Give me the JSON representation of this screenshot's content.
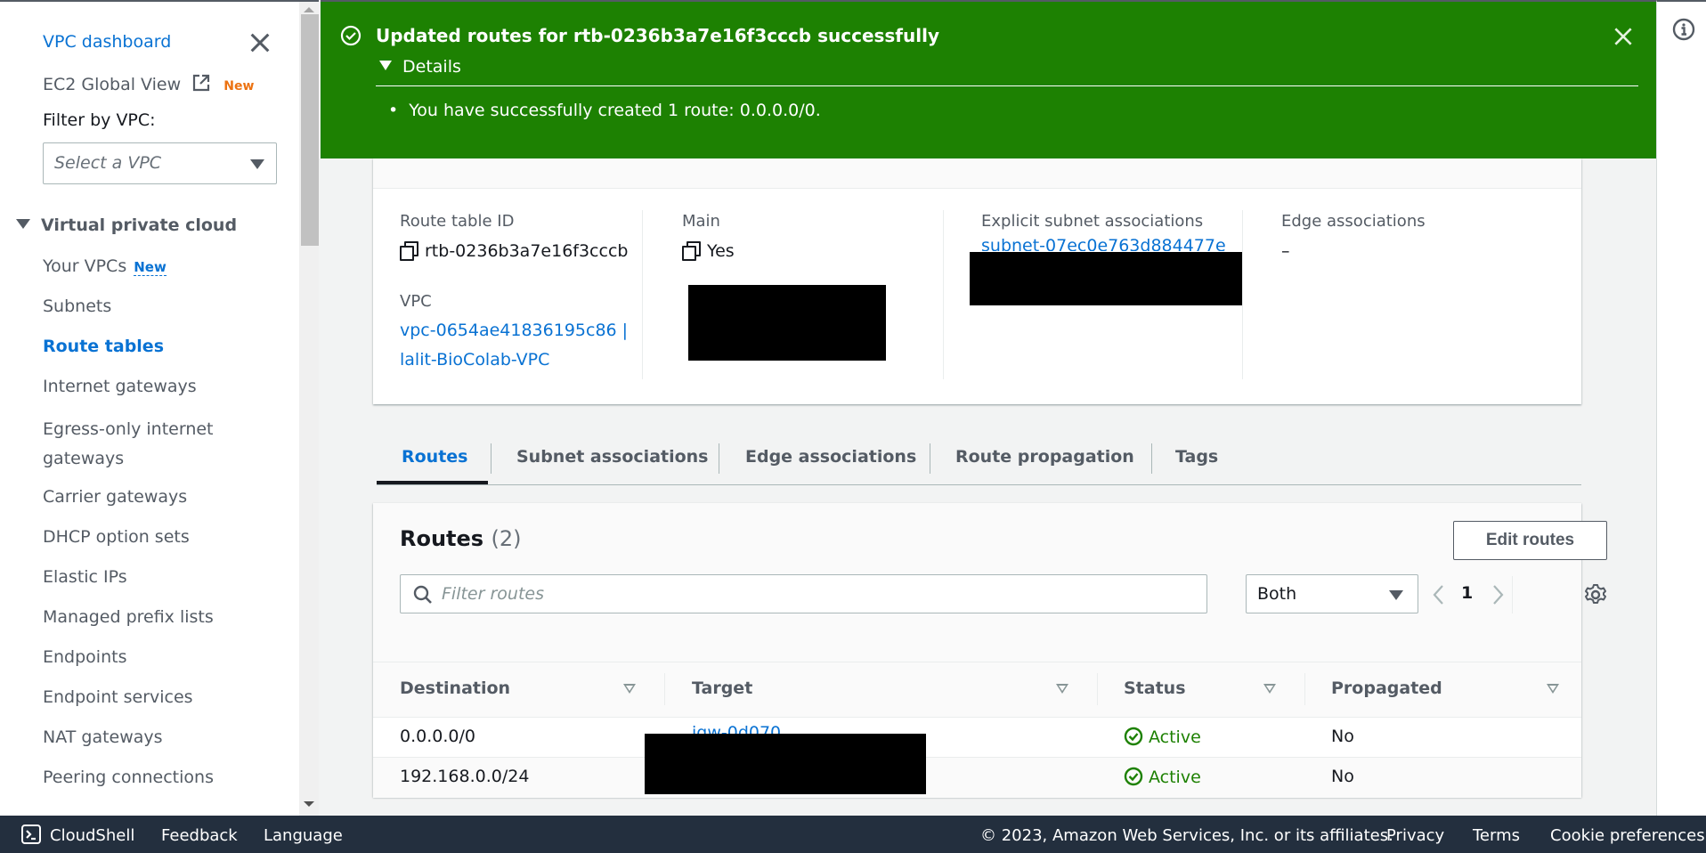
{
  "sidebar": {
    "dashboard_link": "VPC dashboard",
    "global_view_link": "EC2 Global View",
    "global_view_badge": "New",
    "filter_label": "Filter by VPC:",
    "vpc_select_placeholder": "Select a VPC",
    "section_title": "Virtual private cloud",
    "items": [
      {
        "label": "Your VPCs",
        "badge": "New"
      },
      {
        "label": "Subnets"
      },
      {
        "label": "Route tables",
        "active": true
      },
      {
        "label": "Internet gateways"
      },
      {
        "label": "Egress-only internet",
        "label_line2": "gateways"
      },
      {
        "label": "Carrier gateways"
      },
      {
        "label": "DHCP option sets"
      },
      {
        "label": "Elastic IPs"
      },
      {
        "label": "Managed prefix lists"
      },
      {
        "label": "Endpoints"
      },
      {
        "label": "Endpoint services"
      },
      {
        "label": "NAT gateways"
      },
      {
        "label": "Peering connections"
      }
    ]
  },
  "flash": {
    "title": "Updated routes for rtb-0236b3a7e16f3cccb successfully",
    "details_label": "Details",
    "message": "You have successfully created 1 route: 0.0.0.0/0.",
    "color": "#1d8102"
  },
  "summary": {
    "route_table_id_label": "Route table ID",
    "route_table_id": "rtb-0236b3a7e16f3cccb",
    "main_label": "Main",
    "main_value": "Yes",
    "explicit_subnet_label": "Explicit subnet associations",
    "explicit_subnet_value": "subnet-07ec0e763d884477e",
    "edge_label": "Edge associations",
    "edge_value": "–",
    "vpc_label": "VPC",
    "vpc_link_line1": "vpc-0654ae41836195c86 |",
    "vpc_link_line2": "lalit-BioColab-VPC"
  },
  "tabs": [
    {
      "label": "Routes",
      "active": true
    },
    {
      "label": "Subnet associations"
    },
    {
      "label": "Edge associations"
    },
    {
      "label": "Route propagation"
    },
    {
      "label": "Tags"
    }
  ],
  "routes": {
    "title": "Routes",
    "count": "(2)",
    "edit_button": "Edit routes",
    "filter_placeholder": "Filter routes",
    "filter_value": "",
    "type_select": "Both",
    "page": "1",
    "columns": [
      "Destination",
      "Target",
      "Status",
      "Propagated"
    ],
    "rows": [
      {
        "destination": "0.0.0.0/0",
        "target": "igw-0d070...",
        "status": "Active",
        "propagated": "No"
      },
      {
        "destination": "192.168.0.0/24",
        "target": "",
        "status": "Active",
        "propagated": "No"
      }
    ]
  },
  "footer": {
    "cloudshell": "CloudShell",
    "feedback": "Feedback",
    "language": "Language",
    "copyright": "© 2023, Amazon Web Services, Inc. or its affiliates.",
    "privacy": "Privacy",
    "terms": "Terms",
    "cookies": "Cookie preferences"
  },
  "colors": {
    "accent": "#0972d3",
    "success": "#1d8102",
    "footer_bg": "#232f3e"
  }
}
